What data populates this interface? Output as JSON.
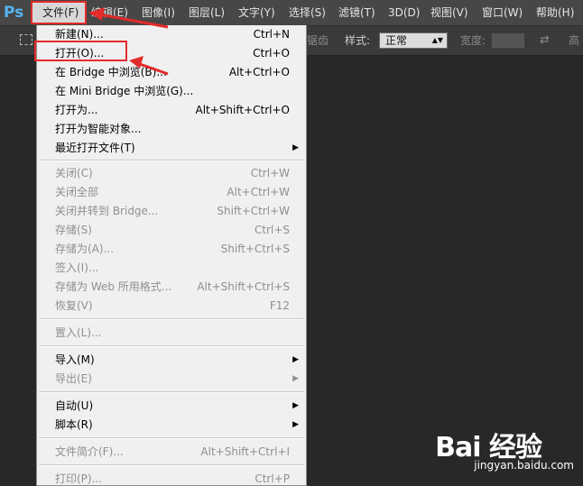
{
  "app": {
    "logo": "Ps"
  },
  "menubar": {
    "items": [
      {
        "label": "文件(F)"
      },
      {
        "label": "编辑(E)"
      },
      {
        "label": "图像(I)"
      },
      {
        "label": "图层(L)"
      },
      {
        "label": "文字(Y)"
      },
      {
        "label": "选择(S)"
      },
      {
        "label": "滤镜(T)"
      },
      {
        "label": "3D(D)"
      },
      {
        "label": "视图(V)"
      },
      {
        "label": "窗口(W)"
      },
      {
        "label": "帮助(H)"
      }
    ]
  },
  "options": {
    "faded_tail": "锯齿",
    "style_label": "样式:",
    "style_value": "正常",
    "width_label": "宽度:",
    "height_label": "高"
  },
  "file_menu": {
    "items": [
      {
        "label": "新建(N)...",
        "shortcut": "Ctrl+N",
        "enabled": true
      },
      {
        "label": "打开(O)...",
        "shortcut": "Ctrl+O",
        "enabled": true
      },
      {
        "label": "在 Bridge 中浏览(B)...",
        "shortcut": "Alt+Ctrl+O",
        "enabled": true
      },
      {
        "label": "在 Mini Bridge 中浏览(G)...",
        "shortcut": "",
        "enabled": true
      },
      {
        "label": "打开为...",
        "shortcut": "Alt+Shift+Ctrl+O",
        "enabled": true
      },
      {
        "label": "打开为智能对象...",
        "shortcut": "",
        "enabled": true
      },
      {
        "label": "最近打开文件(T)",
        "shortcut": "",
        "enabled": true,
        "submenu": true
      },
      {
        "label": "关闭(C)",
        "shortcut": "Ctrl+W",
        "enabled": false
      },
      {
        "label": "关闭全部",
        "shortcut": "Alt+Ctrl+W",
        "enabled": false
      },
      {
        "label": "关闭并转到 Bridge...",
        "shortcut": "Shift+Ctrl+W",
        "enabled": false
      },
      {
        "label": "存储(S)",
        "shortcut": "Ctrl+S",
        "enabled": false
      },
      {
        "label": "存储为(A)...",
        "shortcut": "Shift+Ctrl+S",
        "enabled": false
      },
      {
        "label": "签入(I)...",
        "shortcut": "",
        "enabled": false
      },
      {
        "label": "存储为 Web 所用格式...",
        "shortcut": "Alt+Shift+Ctrl+S",
        "enabled": false
      },
      {
        "label": "恢复(V)",
        "shortcut": "F12",
        "enabled": false
      },
      {
        "label": "置入(L)...",
        "shortcut": "",
        "enabled": false
      },
      {
        "label": "导入(M)",
        "shortcut": "",
        "enabled": true,
        "submenu": true
      },
      {
        "label": "导出(E)",
        "shortcut": "",
        "enabled": false,
        "submenu": true
      },
      {
        "label": "自动(U)",
        "shortcut": "",
        "enabled": true,
        "submenu": true
      },
      {
        "label": "脚本(R)",
        "shortcut": "",
        "enabled": true,
        "submenu": true
      },
      {
        "label": "文件简介(F)...",
        "shortcut": "Alt+Shift+Ctrl+I",
        "enabled": false
      },
      {
        "label": "打印(P)...",
        "shortcut": "Ctrl+P",
        "enabled": false
      }
    ]
  },
  "watermark": {
    "logo_text": "Bai 经验",
    "url": "jingyan.baidu.com"
  },
  "colors": {
    "menubar_bg": "#474747",
    "menu_bg": "#f0f0f0",
    "annotation": "#e22b2b",
    "ps_blue": "#56b3f0"
  }
}
